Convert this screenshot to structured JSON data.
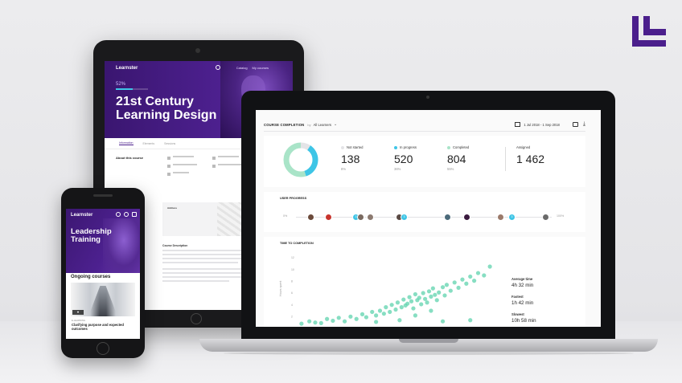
{
  "colors": {
    "brand_purple": "#4b1f8c",
    "not_started": "#e4e4e7",
    "in_progress": "#3ec5e6",
    "completed": "#a9e4c8",
    "scatter": "#5fd3ae"
  },
  "brand": {
    "logo_icon": "brand-logo-icon"
  },
  "tablet": {
    "app_name": "Learnster",
    "nav": [
      "Catalog",
      "My courses"
    ],
    "progress_percent": "52%",
    "progress_value": 0.52,
    "course_title": "21st Century Learning Design",
    "tabs": [
      "Information",
      "Elements",
      "Sessions"
    ],
    "about_heading": "About this course",
    "address_heading": "Address",
    "course_description_heading": "Course Description"
  },
  "phone": {
    "app_name": "Learnster",
    "hero_title": "Leadership Training",
    "section_heading": "Ongoing courses",
    "card_label": "E-LEARNING",
    "card_title": "Clarifying purpose and expected outcomes"
  },
  "dashboard": {
    "title": "COURSE COMPLETION",
    "by_label": "by",
    "learner_filter": "All Learners",
    "date_range": "1 Jul 2018 - 1 Sep 2018",
    "summary": {
      "not_started": {
        "label": "Not started",
        "value": "138",
        "percent": "8%"
      },
      "in_progress": {
        "label": "In progress",
        "value": "520",
        "percent": "36%"
      },
      "completed": {
        "label": "Completed",
        "value": "804",
        "percent": "55%"
      },
      "assigned": {
        "label": "Assigned",
        "value": "1 462"
      }
    },
    "user_progress": {
      "title": "USER PROGRESS",
      "start_label": "0%",
      "end_label": "100%",
      "count_badges": [
        "3",
        "3",
        "3"
      ]
    },
    "time_to_completion": {
      "title": "TIME TO COMPLETION",
      "ylabel": "Hours spent",
      "stats": [
        {
          "label": "Average time",
          "value": "4h 32 min"
        },
        {
          "label": "Fastest",
          "value": "1h 42 min"
        },
        {
          "label": "Slowest",
          "value": "10h 58 min"
        }
      ]
    }
  },
  "chart_data": [
    {
      "type": "pie",
      "categories": [
        "Not started",
        "In progress",
        "Completed"
      ],
      "values": [
        138,
        520,
        804
      ]
    },
    {
      "type": "scatter",
      "title": "TIME TO COMPLETION",
      "ylabel": "Hours spent",
      "ylim": [
        0,
        12
      ],
      "xlim": [
        0,
        100
      ],
      "yticks": [
        "2",
        "4",
        "6",
        "8",
        "10",
        "12"
      ],
      "points": [
        [
          2,
          0.8
        ],
        [
          6,
          1.2
        ],
        [
          9,
          1.0
        ],
        [
          12,
          0.9
        ],
        [
          15,
          1.6
        ],
        [
          18,
          1.3
        ],
        [
          21,
          1.8
        ],
        [
          24,
          1.2
        ],
        [
          27,
          2.0
        ],
        [
          30,
          1.6
        ],
        [
          33,
          2.4
        ],
        [
          35,
          1.9
        ],
        [
          38,
          2.8
        ],
        [
          40,
          2.2
        ],
        [
          42,
          3.0
        ],
        [
          44,
          2.5
        ],
        [
          45,
          3.6
        ],
        [
          47,
          2.8
        ],
        [
          48,
          4.0
        ],
        [
          50,
          3.2
        ],
        [
          51,
          4.4
        ],
        [
          53,
          3.6
        ],
        [
          54,
          4.9
        ],
        [
          55,
          3.9
        ],
        [
          56,
          4.2
        ],
        [
          57,
          5.3
        ],
        [
          58,
          4.6
        ],
        [
          59,
          3.4
        ],
        [
          60,
          5.8
        ],
        [
          61,
          4.8
        ],
        [
          62,
          5.2
        ],
        [
          63,
          4.1
        ],
        [
          64,
          6.0
        ],
        [
          65,
          5.0
        ],
        [
          66,
          4.4
        ],
        [
          67,
          6.3
        ],
        [
          68,
          5.4
        ],
        [
          69,
          6.8
        ],
        [
          70,
          5.7
        ],
        [
          71,
          4.8
        ],
        [
          72,
          6.1
        ],
        [
          74,
          7.0
        ],
        [
          75,
          5.6
        ],
        [
          76,
          7.4
        ],
        [
          78,
          6.4
        ],
        [
          80,
          7.8
        ],
        [
          82,
          6.9
        ],
        [
          84,
          8.3
        ],
        [
          86,
          7.6
        ],
        [
          88,
          8.8
        ],
        [
          90,
          8.1
        ],
        [
          92,
          9.4
        ],
        [
          95,
          9.0
        ],
        [
          98,
          10.5
        ],
        [
          60,
          2.2
        ],
        [
          74,
          1.2
        ],
        [
          88,
          1.4
        ],
        [
          40,
          1.1
        ],
        [
          52,
          1.4
        ],
        [
          68,
          3.0
        ]
      ]
    }
  ]
}
